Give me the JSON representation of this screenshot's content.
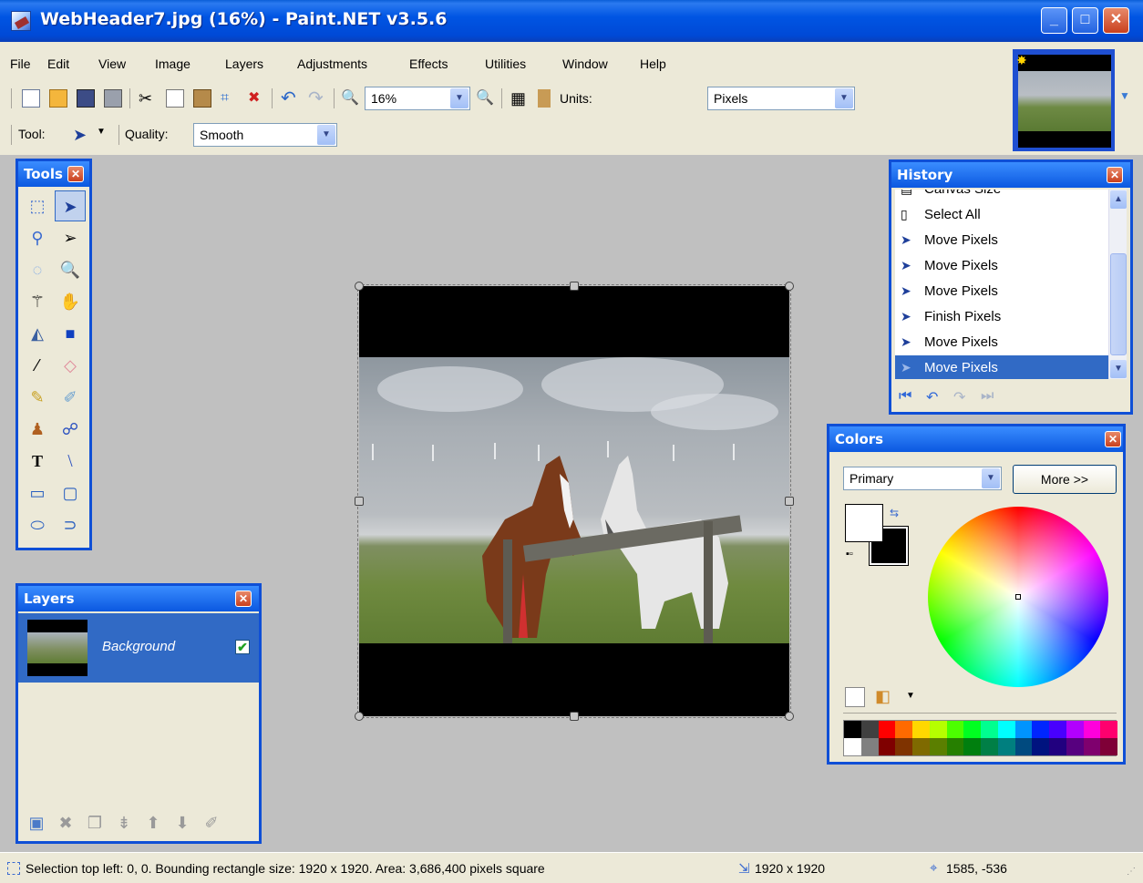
{
  "window": {
    "title": "WebHeader7.jpg (16%) - Paint.NET v3.5.6",
    "controls": [
      "_",
      "□",
      "✕"
    ]
  },
  "menu": [
    "File",
    "Edit",
    "View",
    "Image",
    "Layers",
    "Adjustments",
    "Effects",
    "Utilities",
    "Window",
    "Help"
  ],
  "toolbar": {
    "zoom_value": "16%",
    "units_label": "Units:",
    "units_value": "Pixels"
  },
  "toolbar2": {
    "tool_label": "Tool:",
    "quality_label": "Quality:",
    "quality_value": "Smooth"
  },
  "tools_panel": {
    "title": "Tools",
    "selected_tool": "move-selected-pixels"
  },
  "layers_panel": {
    "title": "Layers",
    "layers": [
      {
        "name": "Background",
        "visible": true
      }
    ]
  },
  "history_panel": {
    "title": "History",
    "items": [
      {
        "label": "Canvas Size",
        "icon": "canvas-size-icon"
      },
      {
        "label": "Select All",
        "icon": "select-all-icon"
      },
      {
        "label": "Move Pixels",
        "icon": "move-pixels-icon"
      },
      {
        "label": "Move Pixels",
        "icon": "move-pixels-icon"
      },
      {
        "label": "Move Pixels",
        "icon": "move-pixels-icon"
      },
      {
        "label": "Finish Pixels",
        "icon": "finish-pixels-icon"
      },
      {
        "label": "Move Pixels",
        "icon": "move-pixels-icon"
      },
      {
        "label": "Move Pixels",
        "icon": "move-pixels-icon",
        "selected": true
      }
    ]
  },
  "colors_panel": {
    "title": "Colors",
    "mode_value": "Primary",
    "more_label": "More >>",
    "primary_color": "#ffffff",
    "secondary_color": "#000000",
    "palette_row1": [
      "#000000",
      "#404040",
      "#ff0000",
      "#ff6a00",
      "#ffd800",
      "#b6ff00",
      "#4cff00",
      "#00ff21",
      "#00ff90",
      "#00ffff",
      "#0094ff",
      "#0026ff",
      "#4800ff",
      "#b200ff",
      "#ff00dc",
      "#ff006e"
    ],
    "palette_row2": [
      "#ffffff",
      "#808080",
      "#7f0000",
      "#7f3300",
      "#7f6a00",
      "#5b7f00",
      "#267f00",
      "#007f0e",
      "#007f46",
      "#007f7f",
      "#004a7f",
      "#00137f",
      "#21007f",
      "#57007f",
      "#7f006e",
      "#7f0037"
    ]
  },
  "status": {
    "selection_text": "Selection top left: 0, 0. Bounding rectangle size: 1920 x 1920. Area: 3,686,400 pixels square",
    "image_size": "1920 x 1920",
    "cursor_pos": "1585, -536"
  },
  "colors": {
    "accent": "#0f4fd6",
    "selection": "#316ac5",
    "chrome": "#ece9d8",
    "workspace": "#c0c0c0"
  }
}
